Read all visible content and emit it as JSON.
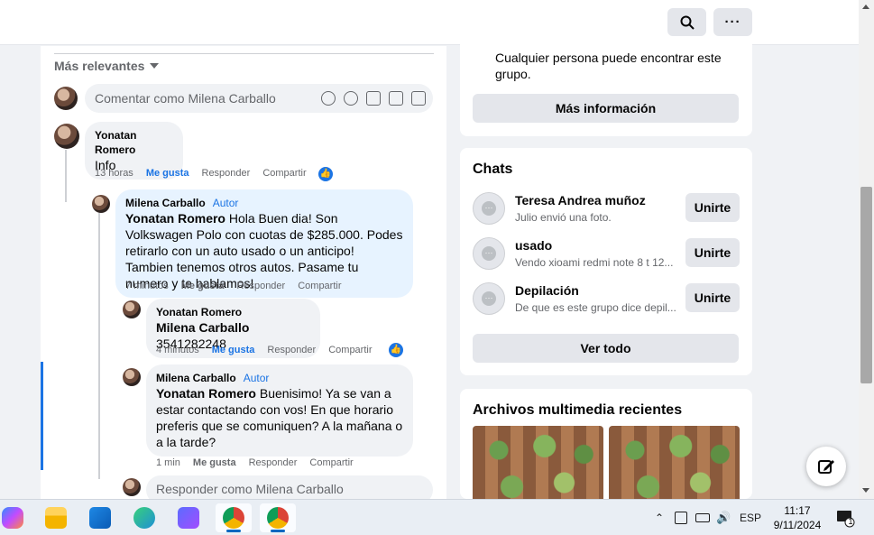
{
  "topbar": {
    "search_icon": "search-icon",
    "more_label": "···"
  },
  "feed": {
    "sort_label": "Más relevantes",
    "compose_placeholder": "Comentar como Milena Carballo",
    "comments": [
      {
        "author": "Yonatan Romero",
        "text": "Info",
        "time": "13 horas",
        "like": "Me gusta",
        "reply": "Responder",
        "share": "Compartir",
        "liked": true,
        "reactions_icon": "like-icon"
      },
      {
        "author": "Milena Carballo",
        "badge": "Autor",
        "mention": "Yonatan Romero",
        "text": "Hola Buen dia! Son Volkswagen Polo con cuotas de $285.000. Podes retirarlo con un auto usado o un anticipo! Tambien tenemos otros autos. Pasame tu numero y te hablamos!",
        "time": "7 minutos",
        "like": "Me gusta",
        "reply": "Responder",
        "share": "Compartir"
      },
      {
        "author": "Yonatan Romero",
        "mention": "Milena Carballo",
        "text": "3541282248",
        "time": "4 minutos",
        "like": "Me gusta",
        "reply": "Responder",
        "share": "Compartir",
        "liked": true
      },
      {
        "author": "Milena Carballo",
        "badge": "Autor",
        "mention": "Yonatan Romero",
        "text": "Buenisimo! Ya se van a estar contactando con vos! En que horario preferis que se comuniquen? A la mañana o a la tarde?",
        "time": "1 min",
        "like": "Me gusta",
        "reply": "Responder",
        "share": "Compartir"
      }
    ],
    "reply_placeholder": "Responder como Milena Carballo"
  },
  "about": {
    "privacy_text": "Cualquier persona puede encontrar este grupo.",
    "more_info_button": "Más información"
  },
  "chats": {
    "title": "Chats",
    "items": [
      {
        "name": "Teresa Andrea muñoz",
        "preview": "Julio envió una foto.",
        "button": "Unirte"
      },
      {
        "name": "usado",
        "preview": "Vendo xioami redmi note 8 t 12...",
        "button": "Unirte"
      },
      {
        "name": "Depilación",
        "preview": "De que es este grupo dice depil...",
        "button": "Unirte"
      }
    ],
    "see_all": "Ver todo"
  },
  "media": {
    "title": "Archivos multimedia recientes"
  },
  "taskbar": {
    "apps": [
      "copilot-icon",
      "file-explorer-icon",
      "mail-icon",
      "edge-icon",
      "app-icon",
      "chrome-profile-icon",
      "chrome-icon"
    ],
    "language": "ESP",
    "time": "11:17",
    "date": "9/11/2024",
    "notification_count": "1"
  }
}
